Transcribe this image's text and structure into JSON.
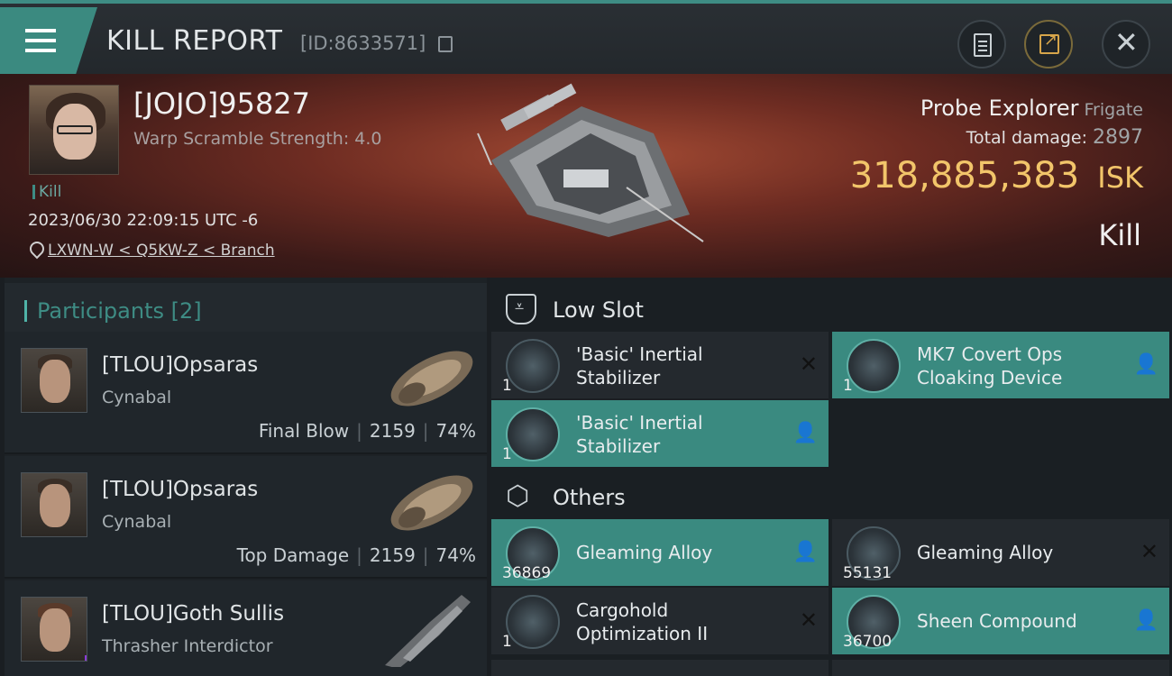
{
  "header": {
    "title": "KILL REPORT",
    "report_id": "[ID:8633571]"
  },
  "victim": {
    "name": "[JOJO]95827",
    "subtitle": "Warp Scramble Strength: 4.0",
    "tag": "Kill",
    "datetime": "2023/06/30 22:09:15 UTC -6",
    "location": "LXWN-W < Q5KW-Z < Branch",
    "ship_name": "Probe Explorer",
    "ship_class": "Frigate",
    "total_damage_label": "Total damage:",
    "total_damage": "2897",
    "isk_value": "318,885,383",
    "isk_unit": "ISK",
    "result": "Kill"
  },
  "participants": {
    "label": "Participants",
    "count": "[2]",
    "rows": [
      {
        "name": "[TLOU]Opsaras",
        "ship": "Cynabal",
        "role": "Final Blow",
        "damage": "2159",
        "percent": "74%"
      },
      {
        "name": "[TLOU]Opsaras",
        "ship": "Cynabal",
        "role": "Top Damage",
        "damage": "2159",
        "percent": "74%"
      },
      {
        "name": "[TLOU]Goth Sullis",
        "ship": "Thrasher Interdictor",
        "badge": "i"
      }
    ]
  },
  "low_slot": {
    "label": "Low Slot",
    "items": [
      {
        "name": "'Basic' Inertial Stabilizer",
        "qty": "1",
        "status": "destroyed"
      },
      {
        "name": "MK7 Covert Ops Cloaking Device",
        "qty": "1",
        "status": "dropped"
      },
      {
        "name": "'Basic' Inertial Stabilizer",
        "qty": "1",
        "status": "dropped"
      }
    ]
  },
  "others": {
    "label": "Others",
    "items": [
      {
        "name": "Gleaming Alloy",
        "qty": "36869",
        "status": "dropped"
      },
      {
        "name": "Gleaming Alloy",
        "qty": "55131",
        "status": "destroyed"
      },
      {
        "name": "Cargohold Optimization II",
        "qty": "1",
        "status": "destroyed"
      },
      {
        "name": "Sheen Compound",
        "qty": "36700",
        "status": "dropped"
      }
    ]
  },
  "icons": {
    "menu": "hamburger-icon",
    "copy": "copy-icon",
    "clipboard": "clipboard-icon",
    "share": "share-icon",
    "close": "close-icon",
    "location": "pin-icon",
    "dropped": "person-icon",
    "destroyed": "x-icon"
  },
  "colors": {
    "accent": "#3a8a80",
    "isk": "#f2c56a",
    "banner": "#6e2c22"
  }
}
